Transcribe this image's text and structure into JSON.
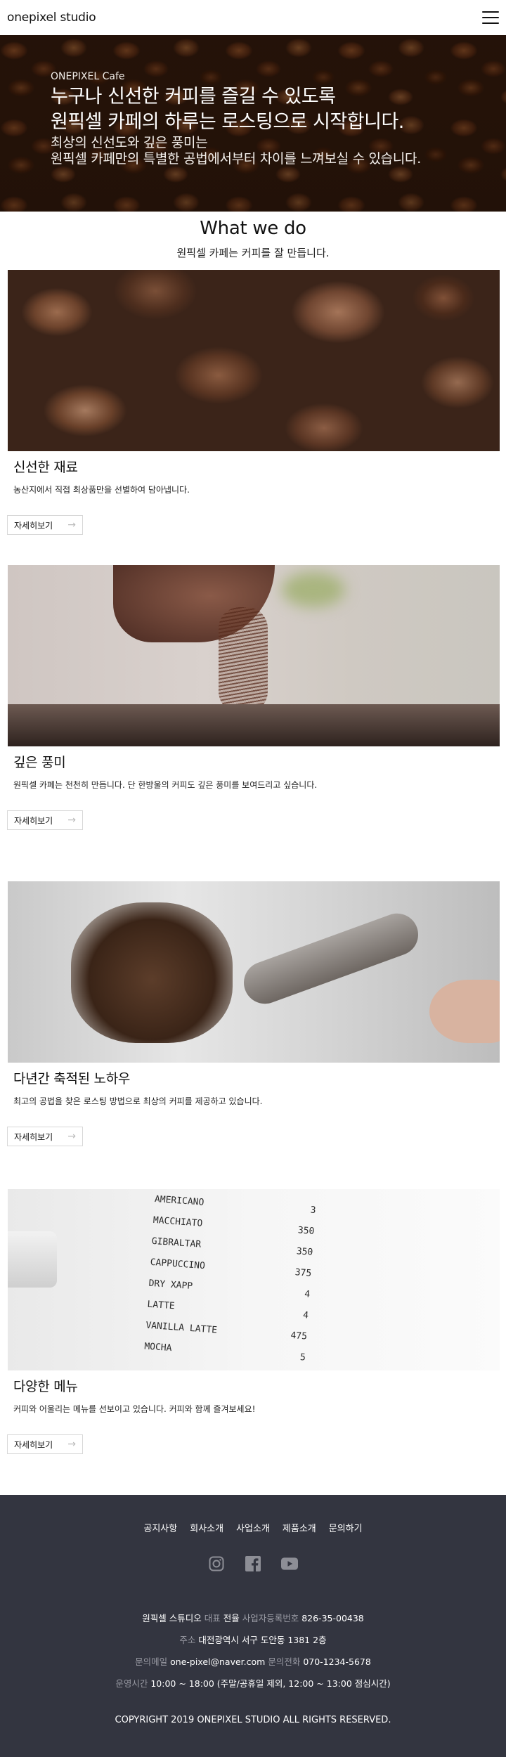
{
  "header": {
    "brand": "onepixel studio"
  },
  "hero": {
    "subtitle": "ONEPIXEL Cafe",
    "title_line1": "누구나 신선한 커피를 즐길 수 있도록",
    "title_line2": "원픽셀 카페의 하루는 로스팅으로 시작합니다.",
    "desc_line1": "최상의 신선도와 깊은 풍미는",
    "desc_line2": "원픽셀 카페만의 특별한 공법에서부터 차이를 느껴보실 수 있습니다."
  },
  "section": {
    "title": "What we do",
    "subtitle": "원픽셀 카페는 커피를 잘 만듭니다."
  },
  "cards": [
    {
      "title": "신선한 재료",
      "desc": "농산지에서 직접 최상품만을 선별하여 담아냅니다.",
      "button": "자세히보기",
      "image": "coffee-beans-photo"
    },
    {
      "title": "깊은 풍미",
      "desc": "원픽셀 카페는 천천히 만듭니다. 단 한방울의 커피도 깊은 풍미를 보여드리고 싶습니다.",
      "button": "자세히보기",
      "image": "pouring-grounds-photo"
    },
    {
      "title": "다년간 축적된 노하우",
      "desc": "최고의 공법을 찾은 로스팅 방법으로 최상의 커피를 제공하고 있습니다.",
      "button": "자세히보기",
      "image": "portafilter-photo"
    },
    {
      "title": "다양한 메뉴",
      "desc": "커피와 어울리는 메뉴를 선보이고 있습니다. 커피와 함께 즐겨보세요!",
      "button": "자세히보기",
      "image": "menu-board-photo"
    }
  ],
  "menu_board": [
    {
      "name": "AMERICANO",
      "price": "3"
    },
    {
      "name": "MACCHIATO",
      "price": "350"
    },
    {
      "name": "GIBRALTAR",
      "price": "350"
    },
    {
      "name": "CAPPUCCINO",
      "price": "375"
    },
    {
      "name": "DRY XAPP",
      "price": "4"
    },
    {
      "name": "LATTE",
      "price": "4"
    },
    {
      "name": "VANILLA LATTE",
      "price": "475"
    },
    {
      "name": "MOCHA",
      "price": "5"
    }
  ],
  "footer": {
    "nav": [
      "공지사항",
      "회사소개",
      "사업소개",
      "제품소개",
      "문의하기"
    ],
    "socials": [
      "instagram-icon",
      "facebook-icon",
      "youtube-icon"
    ],
    "company": "원픽셀 스튜디오",
    "ceo_label": "대표",
    "ceo": "전율",
    "biz_label": "사업자등록번호",
    "biz_no": "826-35-00438",
    "addr_label": "주소",
    "address": "대전광역시 서구 도안동 1381 2층",
    "email_label": "문의메일",
    "email": "one-pixel@naver.com",
    "phone_label": "문의전화",
    "phone": "070-1234-5678",
    "hours_label": "운영시간",
    "hours": "10:00 ~ 18:00 (주말/공휴일 제외, 12:00 ~ 13:00 점심시간)",
    "copyright": "COPYRIGHT 2019 ONEPIXEL STUDIO ALL RIGHTS RESERVED."
  },
  "colors": {
    "footer_bg": "#333540",
    "footer_label": "#9a9ba4"
  }
}
